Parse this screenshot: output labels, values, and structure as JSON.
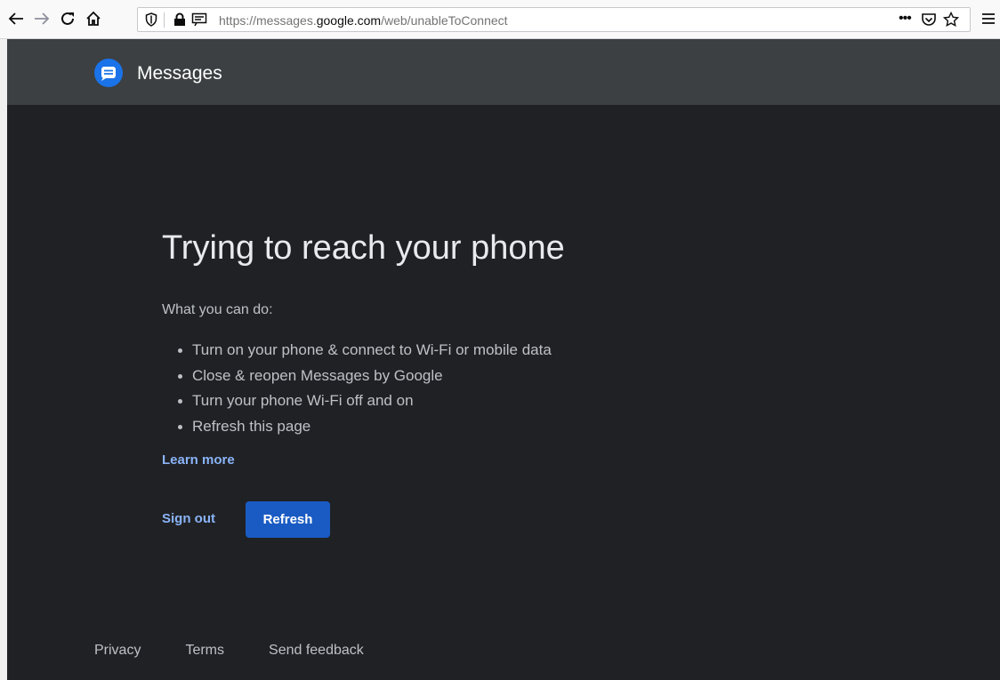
{
  "browser": {
    "url_prefix": "https://messages.",
    "url_host": "google.com",
    "url_path": "/web/unableToConnect",
    "icons": {
      "back": "back-arrow-icon",
      "forward": "forward-arrow-icon",
      "reload": "reload-icon",
      "home": "home-icon",
      "tracking": "shield-icon",
      "lock": "lock-icon",
      "reader": "reader-view-icon",
      "more": "more-actions-icon",
      "pocket": "pocket-icon",
      "bookmark": "star-icon",
      "menu": "hamburger-menu-icon"
    }
  },
  "header": {
    "app_name": "Messages",
    "logo_color": "#1a73e8"
  },
  "main": {
    "headline": "Trying to reach your phone",
    "subhead": "What you can do:",
    "tips": [
      "Turn on your phone & connect to Wi-Fi or mobile data",
      "Close & reopen Messages by Google",
      "Turn your phone Wi-Fi off and on",
      "Refresh this page"
    ],
    "learn_more": "Learn more",
    "sign_out": "Sign out",
    "refresh": "Refresh"
  },
  "footer": {
    "privacy": "Privacy",
    "terms": "Terms",
    "feedback": "Send feedback"
  },
  "colors": {
    "background": "#202124",
    "header": "#3c4043",
    "link": "#8ab4f8",
    "primary_button": "#1a5bc3"
  }
}
